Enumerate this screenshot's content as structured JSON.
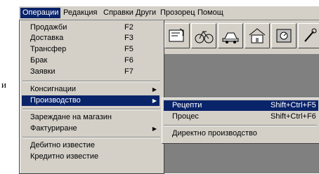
{
  "side_text": "и",
  "menubar": {
    "items": [
      {
        "label": "Операции"
      },
      {
        "label": "Редакция"
      },
      {
        "label": "Справки"
      },
      {
        "label": "Други"
      },
      {
        "label": "Прозорец"
      },
      {
        "label": "Помощ"
      }
    ]
  },
  "toolbar": {
    "buttons": [
      "window-icon",
      "bicycle-icon",
      "car-icon",
      "house-icon",
      "safe-icon",
      "tools-icon"
    ]
  },
  "operations_menu": {
    "items": [
      {
        "label": "Продажби",
        "shortcut": "F2"
      },
      {
        "label": "Доставка",
        "shortcut": "F3"
      },
      {
        "label": "Трансфер",
        "shortcut": "F5"
      },
      {
        "label": "Брак",
        "shortcut": "F6"
      },
      {
        "label": "Заявки",
        "shortcut": "F7"
      },
      {
        "label": "Консигнации"
      },
      {
        "label": "Производство"
      },
      {
        "label": "Зареждане на магазин"
      },
      {
        "label": "Фактуриране"
      },
      {
        "label": "Дебитно известие"
      },
      {
        "label": "Кредитно известие"
      }
    ]
  },
  "production_submenu": {
    "items": [
      {
        "label": "Рецепти",
        "shortcut": "Shift+Ctrl+F5"
      },
      {
        "label": "Процес",
        "shortcut": "Shift+Ctrl+F6"
      },
      {
        "label": "Директно производство"
      }
    ]
  },
  "colors": {
    "highlight": "#0a246a",
    "face": "#d4d0c8",
    "workspace": "#808080"
  }
}
